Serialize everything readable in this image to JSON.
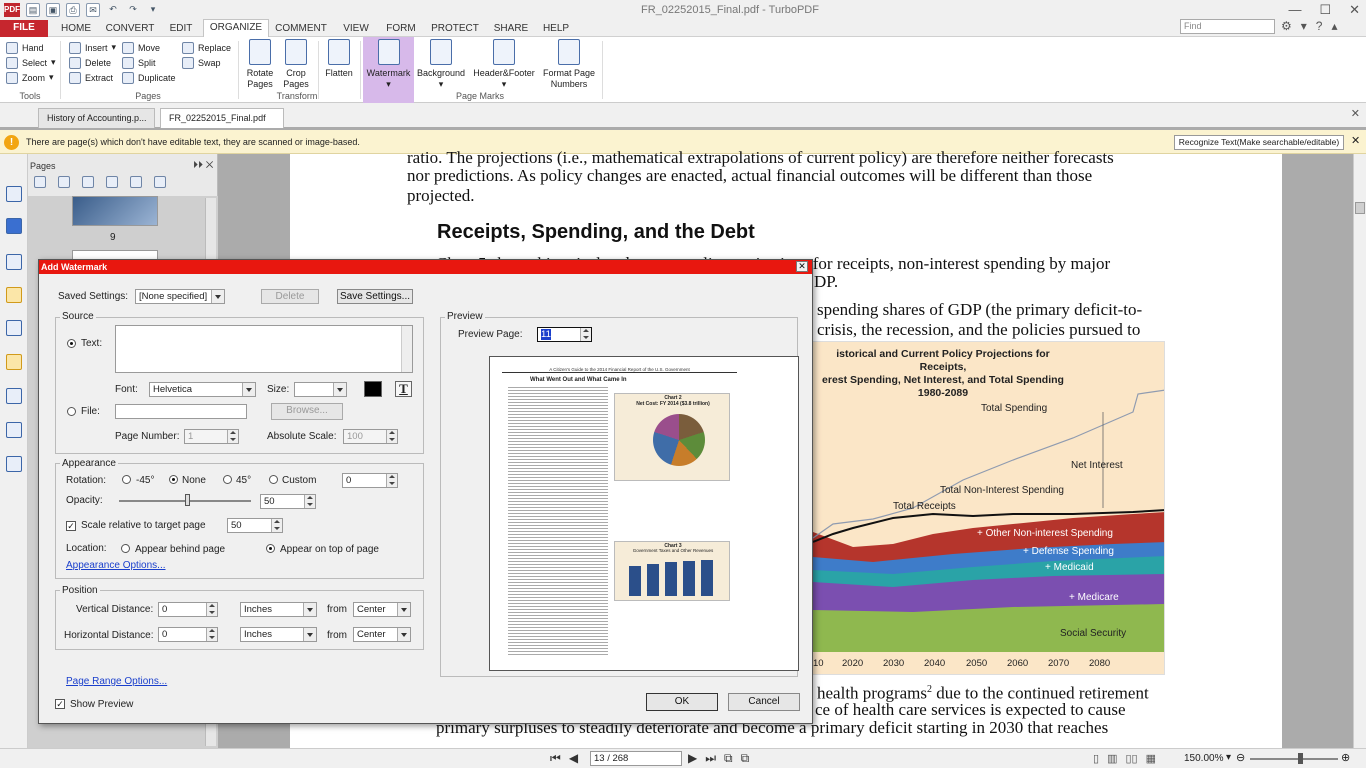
{
  "app": {
    "window_title": "FR_02252015_Final.pdf - TurboPDF",
    "icon_label": "PDF"
  },
  "menu": {
    "tabs": [
      "FILE",
      "HOME",
      "CONVERT",
      "EDIT",
      "ORGANIZE",
      "COMMENT",
      "VIEW",
      "FORM",
      "PROTECT",
      "SHARE",
      "HELP"
    ],
    "active": "ORGANIZE",
    "search_placeholder": "Find"
  },
  "ribbon": {
    "tools": {
      "hand": "Hand",
      "select": "Select",
      "zoom": "Zoom",
      "group": "Tools"
    },
    "pages": {
      "insert": "Insert",
      "move": "Move",
      "replace": "Replace",
      "delete": "Delete",
      "split": "Split",
      "swap": "Swap",
      "extract": "Extract",
      "duplicate": "Duplicate",
      "group": "Pages"
    },
    "transform": {
      "rotate": "Rotate Pages",
      "crop": "Crop Pages",
      "group": "Transform"
    },
    "flatten": "Flatten",
    "page_marks": {
      "watermark": "Watermark",
      "background": "Background",
      "header_footer": "Header&Footer",
      "format_page": "Format Page Numbers",
      "group": "Page Marks"
    }
  },
  "doc_tabs": [
    "History of Accounting.p...",
    "FR_02252015_Final.pdf"
  ],
  "notification": {
    "text": "There are page(s) which don't have editable text, they are scanned or image-based.",
    "button": "Recognize Text(Make searchable/editable)"
  },
  "pages_panel": {
    "title": "Pages",
    "page_label": "9"
  },
  "document": {
    "line1": "ratio.   The projections (i.e., mathematical extrapolations of current policy) are therefore neither forecasts",
    "line2": "nor predictions.  As policy changes are enacted, actual financial outcomes will be different than those",
    "line3": "projected.",
    "heading": "Receipts, Spending, and the Debt",
    "line4": "Chart 5 shows historical and current policy projections for receipts, non-interest spending by major",
    "line4_visible_end": "ions for receipts, non-interest spending by major",
    "line5_visible": "DP.",
    "line6_visible": "spending shares of GDP (the primary deficit-to-",
    "line7_visible": "crisis, the recession, and the policies pursued to",
    "line8_visible_a": "health programs",
    "line8_sup": "2",
    "line8_visible_b": " due to the continued retirement",
    "line9_visible": "ce of health care services is expected to cause",
    "line10": "primary surpluses to steadily deteriorate and become a primary deficit starting in 2030 that reaches"
  },
  "chart": {
    "title_line1": "istorical and Current Policy Projections for Receipts,",
    "title_line2": "erest Spending, Net Interest, and Total Spending",
    "title_line3": "1980-2089",
    "labels": {
      "total_spending": "Total Spending",
      "net_interest": "Net Interest",
      "total_non_interest": "Total Non-Interest Spending",
      "total_receipts": "Total Receipts",
      "other_non_interest": "+ Other Non-interest Spending",
      "defense": "+ Defense Spending",
      "medicaid": "+ Medicaid",
      "medicare": "+ Medicare",
      "social_security": "Social Security"
    },
    "x_ticks": [
      "10",
      "2020",
      "2030",
      "2040",
      "2050",
      "2060",
      "2070",
      "2080"
    ],
    "colors": {
      "other": "#b5352c",
      "defense": "#3e7cc9",
      "medicaid": "#2aa3a7",
      "medicare": "#7b4fb0",
      "social_security": "#8fb84f",
      "background": "#fbe6c7"
    }
  },
  "status_bar": {
    "page_field": "13 / 268",
    "zoom": "150.00%"
  },
  "dialog": {
    "title": "Add Watermark",
    "saved_settings_label": "Saved Settings:",
    "saved_settings_value": "[None specified]",
    "delete_button": "Delete",
    "save_settings_button": "Save Settings...",
    "source": {
      "legend": "Source",
      "text_label": "Text:",
      "text_value": "",
      "font_label": "Font:",
      "font_value": "Helvetica",
      "size_label": "Size:",
      "size_value": "",
      "file_label": "File:",
      "file_value": "",
      "browse_button": "Browse...",
      "page_number_label": "Page Number:",
      "page_number_value": "1",
      "absolute_scale_label": "Absolute Scale:",
      "absolute_scale_value": "100"
    },
    "appearance": {
      "legend": "Appearance",
      "rotation_label": "Rotation:",
      "rotation_options": [
        "-45°",
        "None",
        "45°",
        "Custom"
      ],
      "rotation_selected": "None",
      "custom_value": "0",
      "opacity_label": "Opacity:",
      "opacity_value": "50",
      "scale_label": "Scale relative to target page",
      "scale_checked": true,
      "scale_value": "50",
      "location_label": "Location:",
      "location_options": [
        "Appear behind page",
        "Appear on top of page"
      ],
      "location_selected": "Appear on top of page",
      "options_link": "Appearance Options..."
    },
    "position": {
      "legend": "Position",
      "vertical_label": "Vertical Distance:",
      "vertical_value": "0",
      "vertical_unit": "Inches",
      "vertical_from_label": "from",
      "vertical_from": "Center",
      "horizontal_label": "Horizontal Distance:",
      "horizontal_value": "0",
      "horizontal_unit": "Inches",
      "horizontal_from_label": "from",
      "horizontal_from": "Center"
    },
    "page_range_link": "Page Range Options...",
    "show_preview_label": "Show Preview",
    "show_preview_checked": true,
    "preview": {
      "legend": "Preview",
      "page_label": "Preview Page:",
      "page_value": "11",
      "doc_header": "A Citizen's Guide to the 2014 Financial Report of the U.S. Government",
      "doc_title": "What Went Out and What Came In",
      "chart_title": "Chart 2",
      "chart_subtitle": "Net Cost: FY 2014 ($3.8 trillion)",
      "chart3_title": "Chart 3",
      "chart3_subtitle": "Government Taxes and Other Revenues"
    },
    "ok_button": "OK",
    "cancel_button": "Cancel"
  }
}
